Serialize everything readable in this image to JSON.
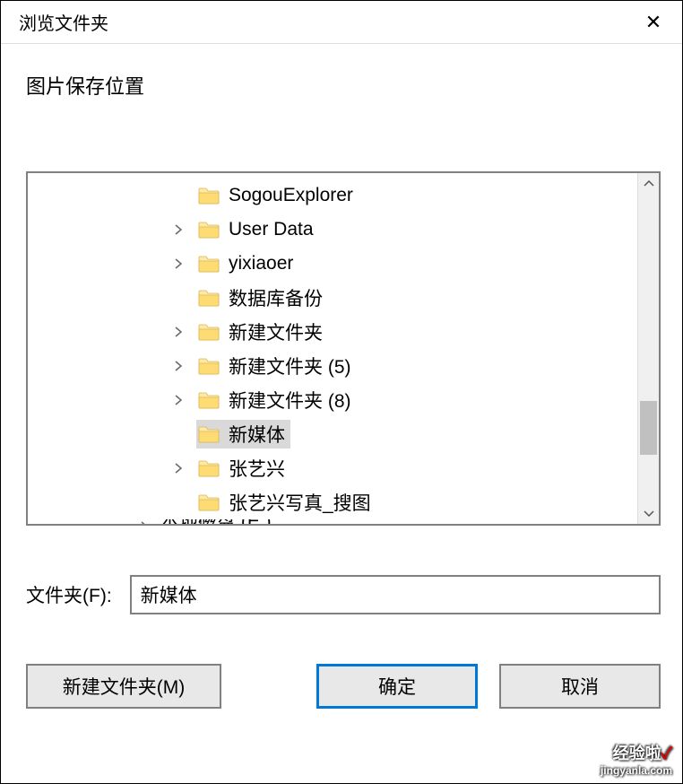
{
  "window": {
    "title": "浏览文件夹",
    "close_symbol": "✕"
  },
  "dialog": {
    "subtitle": "图片保存位置",
    "folder_label": "文件夹(F):",
    "folder_value": "新媒体"
  },
  "tree": {
    "items": [
      {
        "label": "SogouExplorer",
        "expandable": false,
        "selected": false
      },
      {
        "label": "User Data",
        "expandable": true,
        "selected": false
      },
      {
        "label": "yixiaoer",
        "expandable": true,
        "selected": false
      },
      {
        "label": "数据库备份",
        "expandable": false,
        "selected": false
      },
      {
        "label": "新建文件夹",
        "expandable": true,
        "selected": false
      },
      {
        "label": "新建文件夹 (5)",
        "expandable": true,
        "selected": false
      },
      {
        "label": "新建文件夹 (8)",
        "expandable": true,
        "selected": false
      },
      {
        "label": "新媒体",
        "expandable": false,
        "selected": true
      },
      {
        "label": "张艺兴",
        "expandable": true,
        "selected": false
      },
      {
        "label": "张艺兴写真_搜图",
        "expandable": false,
        "selected": false
      }
    ],
    "partial_item": "本地磁盘 (E:)"
  },
  "buttons": {
    "new_folder": "新建文件夹(M)",
    "ok": "确定",
    "cancel": "取消"
  },
  "scroll": {
    "up": "⌃",
    "down": "⌄"
  },
  "watermark": {
    "line1": "经验啦",
    "line2": "jingyanla.com"
  }
}
